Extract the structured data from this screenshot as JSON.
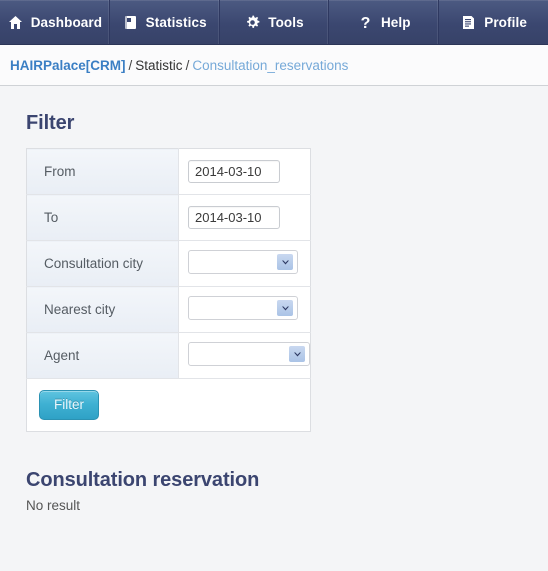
{
  "nav": {
    "items": [
      {
        "label": "Dashboard",
        "icon": "home-icon"
      },
      {
        "label": "Statistics",
        "icon": "book-icon"
      },
      {
        "label": "Tools",
        "icon": "gear-icon"
      },
      {
        "label": "Help",
        "icon": "question-mark-icon"
      },
      {
        "label": "Profile",
        "icon": "document-icon"
      }
    ]
  },
  "breadcrumb": {
    "root": "HAIRPalace[CRM]",
    "separator": "/",
    "middle": "Statistic",
    "current": "Consultation_reservations"
  },
  "filter": {
    "heading": "Filter",
    "rows": [
      {
        "label": "From",
        "control": "date",
        "value": "2014-03-10"
      },
      {
        "label": "To",
        "control": "date",
        "value": "2014-03-10"
      },
      {
        "label": "Consultation city",
        "control": "select",
        "value": ""
      },
      {
        "label": "Nearest city",
        "control": "select",
        "value": ""
      },
      {
        "label": "Agent",
        "control": "select",
        "value": ""
      }
    ],
    "submit_label": "Filter"
  },
  "results": {
    "heading": "Consultation reservation",
    "empty_text": "No result"
  },
  "colors": {
    "nav_bg": "#3b4770",
    "accent_link": "#3b7fc4",
    "heading": "#3b4570",
    "button": "#3eb0d2",
    "page_bg": "#f4f5f7"
  }
}
